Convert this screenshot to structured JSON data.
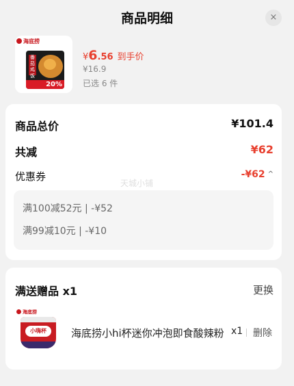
{
  "header": {
    "title": "商品明细",
    "close_icon": "×"
  },
  "product": {
    "brand_text": "海底捞",
    "package_tag": "番茄鸡饭",
    "package_badge": "20%",
    "price_currency": "¥",
    "price_int": "6",
    "price_dec": ".56",
    "price_note": "到手价",
    "original_price": "¥16.9",
    "selected_count": "已选 6 件"
  },
  "summary": {
    "total_label": "商品总价",
    "total_value": "¥101.4",
    "discount_label": "共减",
    "discount_value": "¥62",
    "coupon_label": "优惠券",
    "coupon_value": "-¥62",
    "coupon_toggle_icon": "^",
    "watermark": "天城小铺",
    "coupons": [
      {
        "text": "满100减52元 | -¥52"
      },
      {
        "text": "满99减10元 | -¥10"
      }
    ]
  },
  "gift": {
    "title": "满送赠品 x1",
    "change_label": "更换",
    "brand_text": "海底捞",
    "cup_logo": "小嗨杯",
    "name": "海底捞小hi杯迷你冲泡即食酸辣粉",
    "qty": "x1",
    "delete_label": "删除"
  },
  "colors": {
    "accent_red": "#e8402f",
    "background": "#f2f2f2",
    "card": "#ffffff"
  }
}
